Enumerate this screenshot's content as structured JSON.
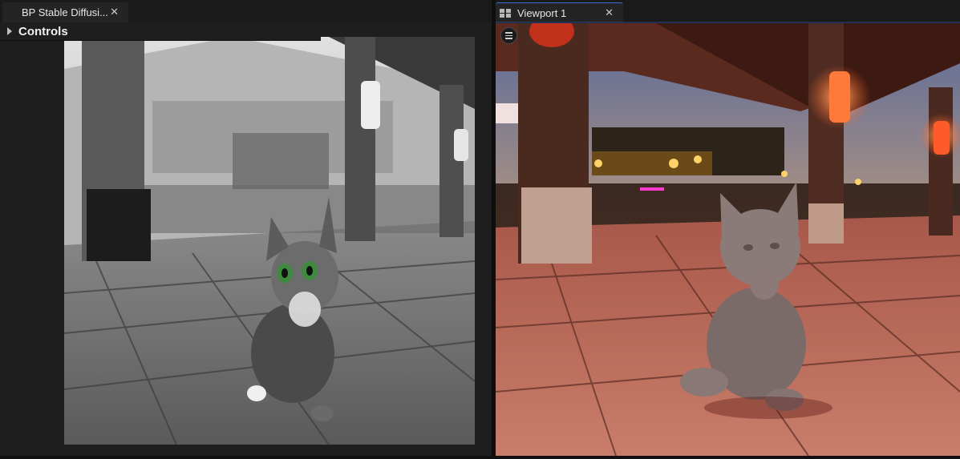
{
  "left_tab": {
    "label": "BP Stable Diffusi...",
    "close": "✕"
  },
  "controls": {
    "title": "Controls"
  },
  "right_tab": {
    "label": "Viewport 1",
    "close": "✕"
  },
  "colors": {
    "tab_bg": "#242424",
    "panel_bg": "#1e1e1e",
    "accent": "#3a6fd8"
  },
  "icons": [
    "close-icon",
    "expand-arrow-icon",
    "viewport-grid-icon",
    "hamburger-menu-icon"
  ]
}
